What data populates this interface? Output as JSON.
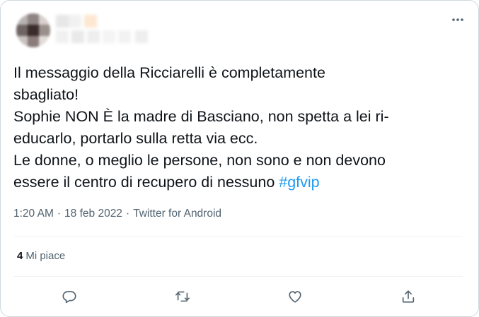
{
  "tweet": {
    "lines": [
      "Il messaggio della Ricciarelli è completamente",
      "sbagliato!",
      "Sophie NON È la madre di Basciano, non spetta a lei ri-",
      "educarlo, portarlo sulla retta via ecc.",
      "Le donne, o meglio le persone, non sono e non devono",
      "essere il centro di recupero di nessuno "
    ],
    "hashtag": "#gfvip"
  },
  "meta": {
    "time": "1:20 AM",
    "separator": "·",
    "date": "18 feb 2022",
    "source": "Twitter for Android"
  },
  "stats": {
    "likes_count": "4",
    "likes_label": "Mi piace"
  },
  "icons": {
    "more": "more-icon",
    "reply": "reply-icon",
    "retweet": "retweet-icon",
    "like": "like-icon",
    "share": "share-icon"
  },
  "colors": {
    "accent": "#1d9bf0",
    "text": "#0f1419",
    "secondary": "#536471",
    "border": "#cfd9de"
  }
}
